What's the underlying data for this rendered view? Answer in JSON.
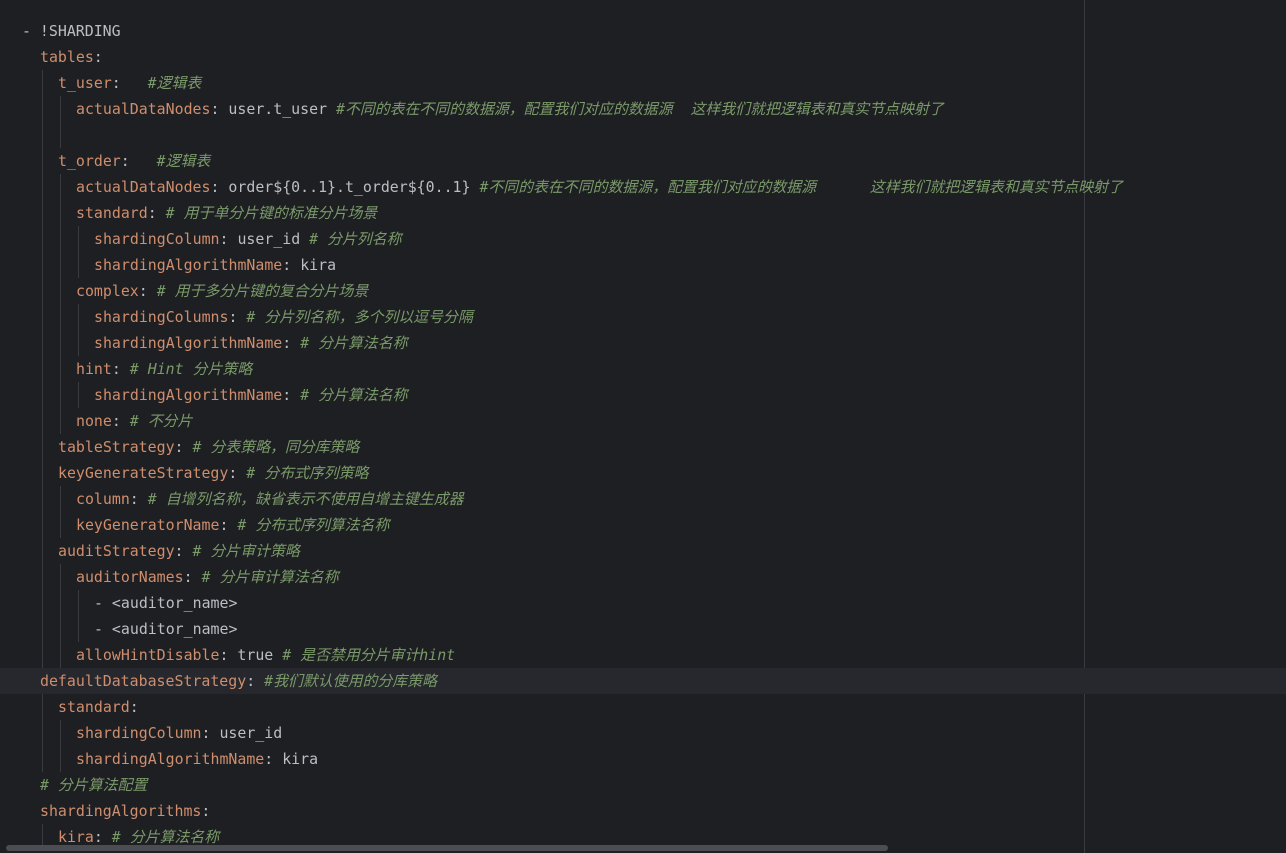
{
  "editor": {
    "language": "yaml",
    "current_line_index": 25,
    "colors": {
      "background": "#1e1f22",
      "key": "#cf8e6d",
      "comment": "#7a9a69",
      "text": "#bcbec4",
      "current_line": "#26282e"
    },
    "lines": [
      {
        "indent": 0,
        "key": "",
        "text": "- !SHARDING",
        "comment": ""
      },
      {
        "indent": 1,
        "key": "tables",
        "text": "",
        "comment": ""
      },
      {
        "indent": 2,
        "key": "t_user",
        "text": " ",
        "comment": "#逻辑表"
      },
      {
        "indent": 3,
        "key": "actualDataNodes",
        "text": "user.t_user",
        "comment": "#不同的表在不同的数据源，配置我们对应的数据源  这样我们就把逻辑表和真实节点映射了"
      },
      {
        "indent": 3,
        "key": "",
        "text": "",
        "comment": ""
      },
      {
        "indent": 2,
        "key": "t_order",
        "text": " ",
        "comment": "#逻辑表"
      },
      {
        "indent": 3,
        "key": "actualDataNodes",
        "text": "order${0..1}.t_order${0..1}",
        "comment": "#不同的表在不同的数据源，配置我们对应的数据源      这样我们就把逻辑表和真实节点映射了"
      },
      {
        "indent": 3,
        "key": "standard",
        "text": "",
        "comment": "# 用于单分片键的标准分片场景"
      },
      {
        "indent": 4,
        "key": "shardingColumn",
        "text": "user_id",
        "comment": "# 分片列名称"
      },
      {
        "indent": 4,
        "key": "shardingAlgorithmName",
        "text": "kira",
        "comment": ""
      },
      {
        "indent": 3,
        "key": "complex",
        "text": "",
        "comment": "# 用于多分片键的复合分片场景"
      },
      {
        "indent": 4,
        "key": "shardingColumns",
        "text": "",
        "comment": "# 分片列名称，多个列以逗号分隔"
      },
      {
        "indent": 4,
        "key": "shardingAlgorithmName",
        "text": "",
        "comment": "# 分片算法名称"
      },
      {
        "indent": 3,
        "key": "hint",
        "text": "",
        "comment": "# Hint 分片策略"
      },
      {
        "indent": 4,
        "key": "shardingAlgorithmName",
        "text": "",
        "comment": "# 分片算法名称"
      },
      {
        "indent": 3,
        "key": "none",
        "text": "",
        "comment": "# 不分片"
      },
      {
        "indent": 2,
        "key": "tableStrategy",
        "text": "",
        "comment": "# 分表策略，同分库策略"
      },
      {
        "indent": 2,
        "key": "keyGenerateStrategy",
        "text": "",
        "comment": "# 分布式序列策略"
      },
      {
        "indent": 3,
        "key": "column",
        "text": "",
        "comment": "# 自增列名称，缺省表示不使用自增主键生成器"
      },
      {
        "indent": 3,
        "key": "keyGeneratorName",
        "text": "",
        "comment": "# 分布式序列算法名称"
      },
      {
        "indent": 2,
        "key": "auditStrategy",
        "text": "",
        "comment": "# 分片审计策略"
      },
      {
        "indent": 3,
        "key": "auditorNames",
        "text": "",
        "comment": "# 分片审计算法名称"
      },
      {
        "indent": 4,
        "key": "",
        "text": "- <auditor_name>",
        "comment": ""
      },
      {
        "indent": 4,
        "key": "",
        "text": "- <auditor_name>",
        "comment": ""
      },
      {
        "indent": 3,
        "key": "allowHintDisable",
        "text": "true",
        "comment": "# 是否禁用分片审计hint"
      },
      {
        "indent": 1,
        "key": "defaultDatabaseStrategy",
        "text": "",
        "comment": "#我们默认使用的分库策略"
      },
      {
        "indent": 2,
        "key": "standard",
        "text": "",
        "comment": ""
      },
      {
        "indent": 3,
        "key": "shardingColumn",
        "text": "user_id",
        "comment": ""
      },
      {
        "indent": 3,
        "key": "shardingAlgorithmName",
        "text": "kira",
        "comment": ""
      },
      {
        "indent": 1,
        "key": "",
        "text": "",
        "comment": "# 分片算法配置"
      },
      {
        "indent": 1,
        "key": "shardingAlgorithms",
        "text": "",
        "comment": ""
      },
      {
        "indent": 2,
        "key": "kira",
        "text": "",
        "comment": "# 分片算法名称"
      }
    ]
  }
}
